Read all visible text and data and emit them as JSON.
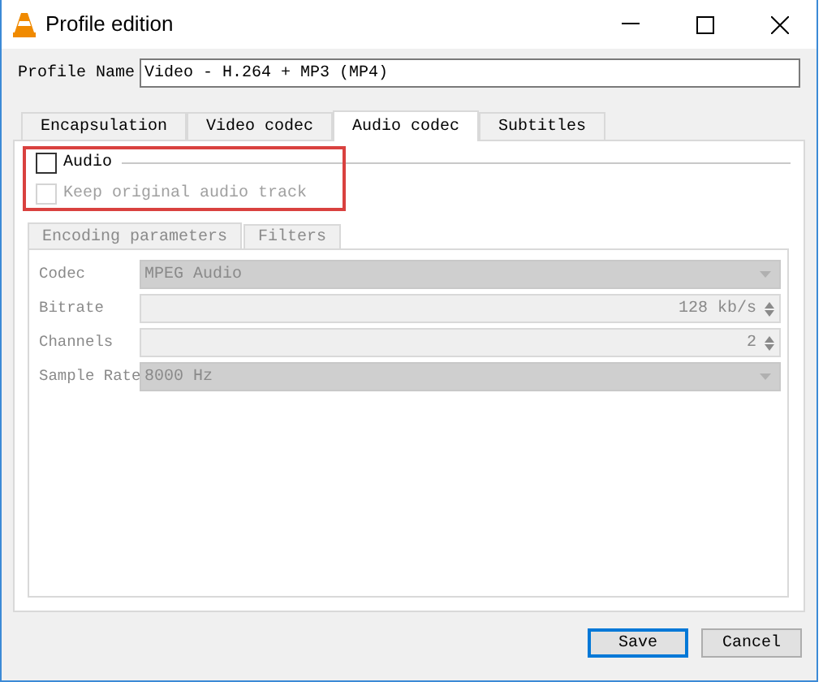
{
  "window": {
    "title": "Profile edition"
  },
  "profile_name": {
    "label": "Profile Name",
    "value": "Video - H.264 + MP3 (MP4)"
  },
  "tabs": [
    {
      "label": "Encapsulation",
      "selected": false
    },
    {
      "label": "Video codec",
      "selected": false
    },
    {
      "label": "Audio codec",
      "selected": true
    },
    {
      "label": "Subtitles",
      "selected": false
    }
  ],
  "audio": {
    "label": "Audio",
    "checked": false
  },
  "keep_original": {
    "label": "Keep original audio track",
    "checked": false,
    "disabled": true
  },
  "inner_tabs": [
    {
      "label": "Encoding parameters",
      "selected": true
    },
    {
      "label": "Filters",
      "selected": false
    }
  ],
  "fields": [
    {
      "kind": "dropdown",
      "label": "Codec",
      "value": "MPEG Audio",
      "disabled": true
    },
    {
      "kind": "spinbox",
      "label": "Bitrate",
      "value": "128 kb/s",
      "disabled": true
    },
    {
      "kind": "spinbox",
      "label": "Channels",
      "value": "2",
      "disabled": true
    },
    {
      "kind": "dropdown",
      "label": "Sample Rate",
      "value": "8000 Hz",
      "disabled": true
    }
  ],
  "buttons": [
    {
      "label": "Save",
      "default": true
    },
    {
      "label": "Cancel",
      "default": false
    }
  ]
}
